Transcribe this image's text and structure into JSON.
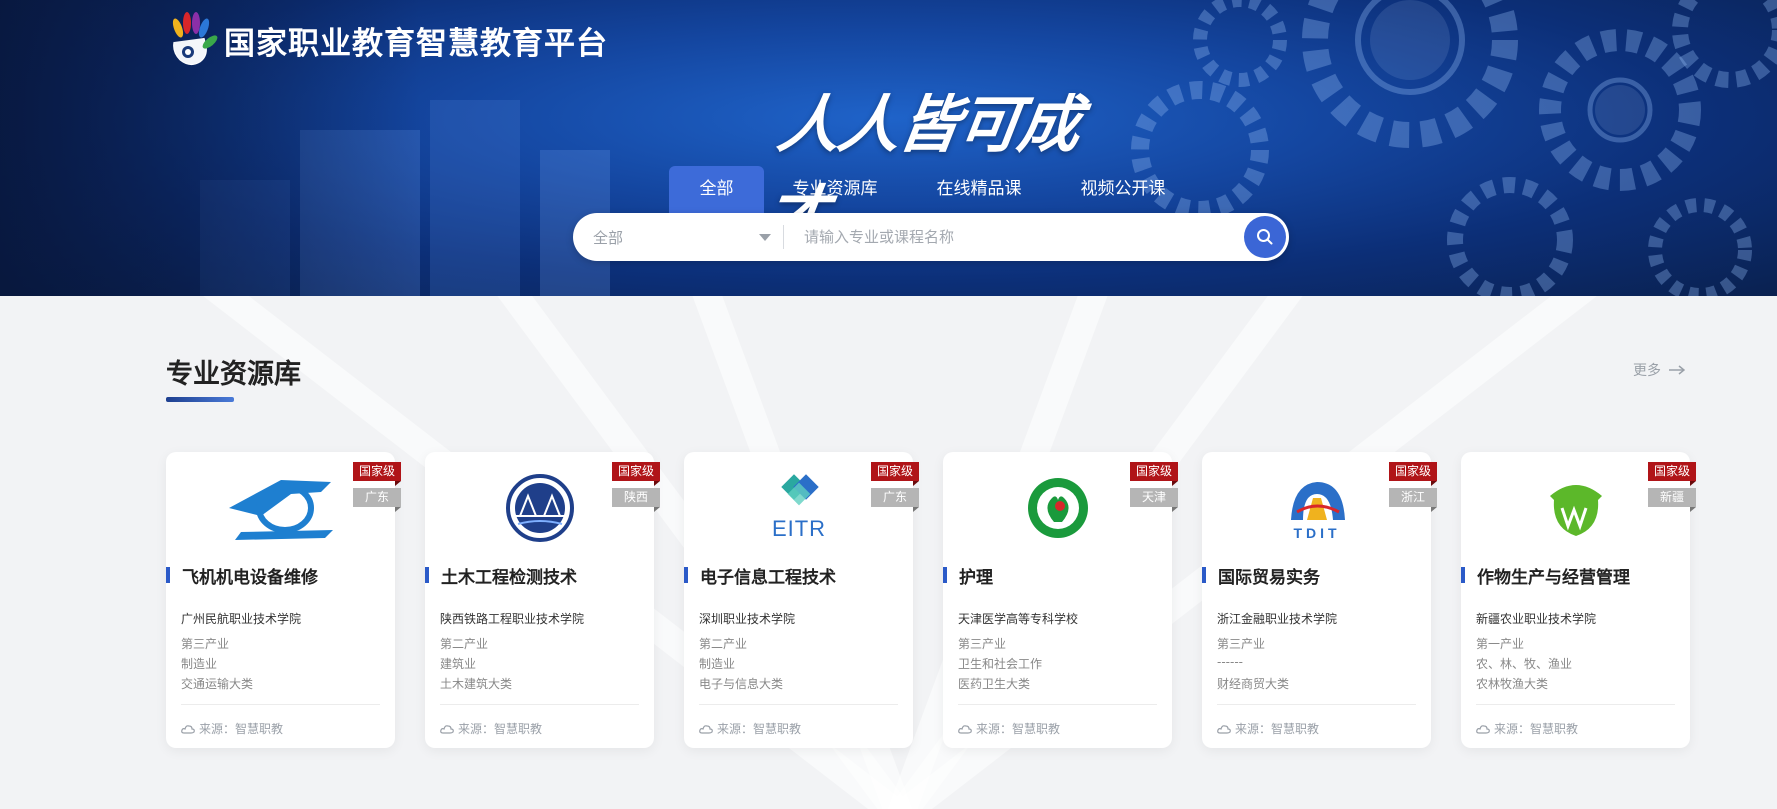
{
  "header": {
    "brand": "国家职业教育智慧教育平台",
    "slogan": "人人皆可成才"
  },
  "nav": {
    "tabs": [
      {
        "label": "全部",
        "active": true
      },
      {
        "label": "专业资源库",
        "active": false
      },
      {
        "label": "在线精品课",
        "active": false
      },
      {
        "label": "视频公开课",
        "active": false
      }
    ]
  },
  "search": {
    "category_value": "全部",
    "placeholder": "请输入专业或课程名称",
    "icon": "search-icon"
  },
  "section": {
    "title": "专业资源库",
    "more_label": "更多"
  },
  "cards": [
    {
      "title": "飞机机电设备维修",
      "school": "广州民航职业技术学院",
      "line1": "第三产业",
      "line2": "制造业",
      "line3": "交通运输大类",
      "level": "国家级",
      "region": "广东",
      "source": "来源：智慧职教",
      "logo": "plane-logo"
    },
    {
      "title": "土木工程检测技术",
      "school": "陕西铁路工程职业技术学院",
      "line1": "第二产业",
      "line2": "建筑业",
      "line3": "土木建筑大类",
      "level": "国家级",
      "region": "陕西",
      "source": "来源：智慧职教",
      "logo": "bridge-emblem-logo"
    },
    {
      "title": "电子信息工程技术",
      "school": "深圳职业技术学院",
      "line1": "第二产业",
      "line2": "制造业",
      "line3": "电子与信息大类",
      "level": "国家级",
      "region": "广东",
      "source": "来源：智慧职教",
      "logo": "eitr-logo"
    },
    {
      "title": "护理",
      "school": "天津医学高等专科学校",
      "line1": "第三产业",
      "line2": "卫生和社会工作",
      "line3": "医药卫生大类",
      "level": "国家级",
      "region": "天津",
      "source": "来源：智慧职教",
      "logo": "nursing-emblem-logo"
    },
    {
      "title": "国际贸易实务",
      "school": "浙江金融职业技术学院",
      "line1": "第三产业",
      "line2": "------",
      "line3": "财经商贸大类",
      "level": "国家级",
      "region": "浙江",
      "source": "来源：智慧职教",
      "logo": "tdit-logo"
    },
    {
      "title": "作物生产与经营管理",
      "school": "新疆农业职业技术学院",
      "line1": "第一产业",
      "line2": "农、林、牧、渔业",
      "line3": "农林牧渔大类",
      "level": "国家级",
      "region": "新疆",
      "source": "来源：智慧职教",
      "logo": "agri-logo"
    }
  ],
  "colors": {
    "accent": "#3d6bd9",
    "badge_level": "#b01418",
    "badge_region": "#b5b5b5",
    "hero_dark": "#0a2150"
  }
}
